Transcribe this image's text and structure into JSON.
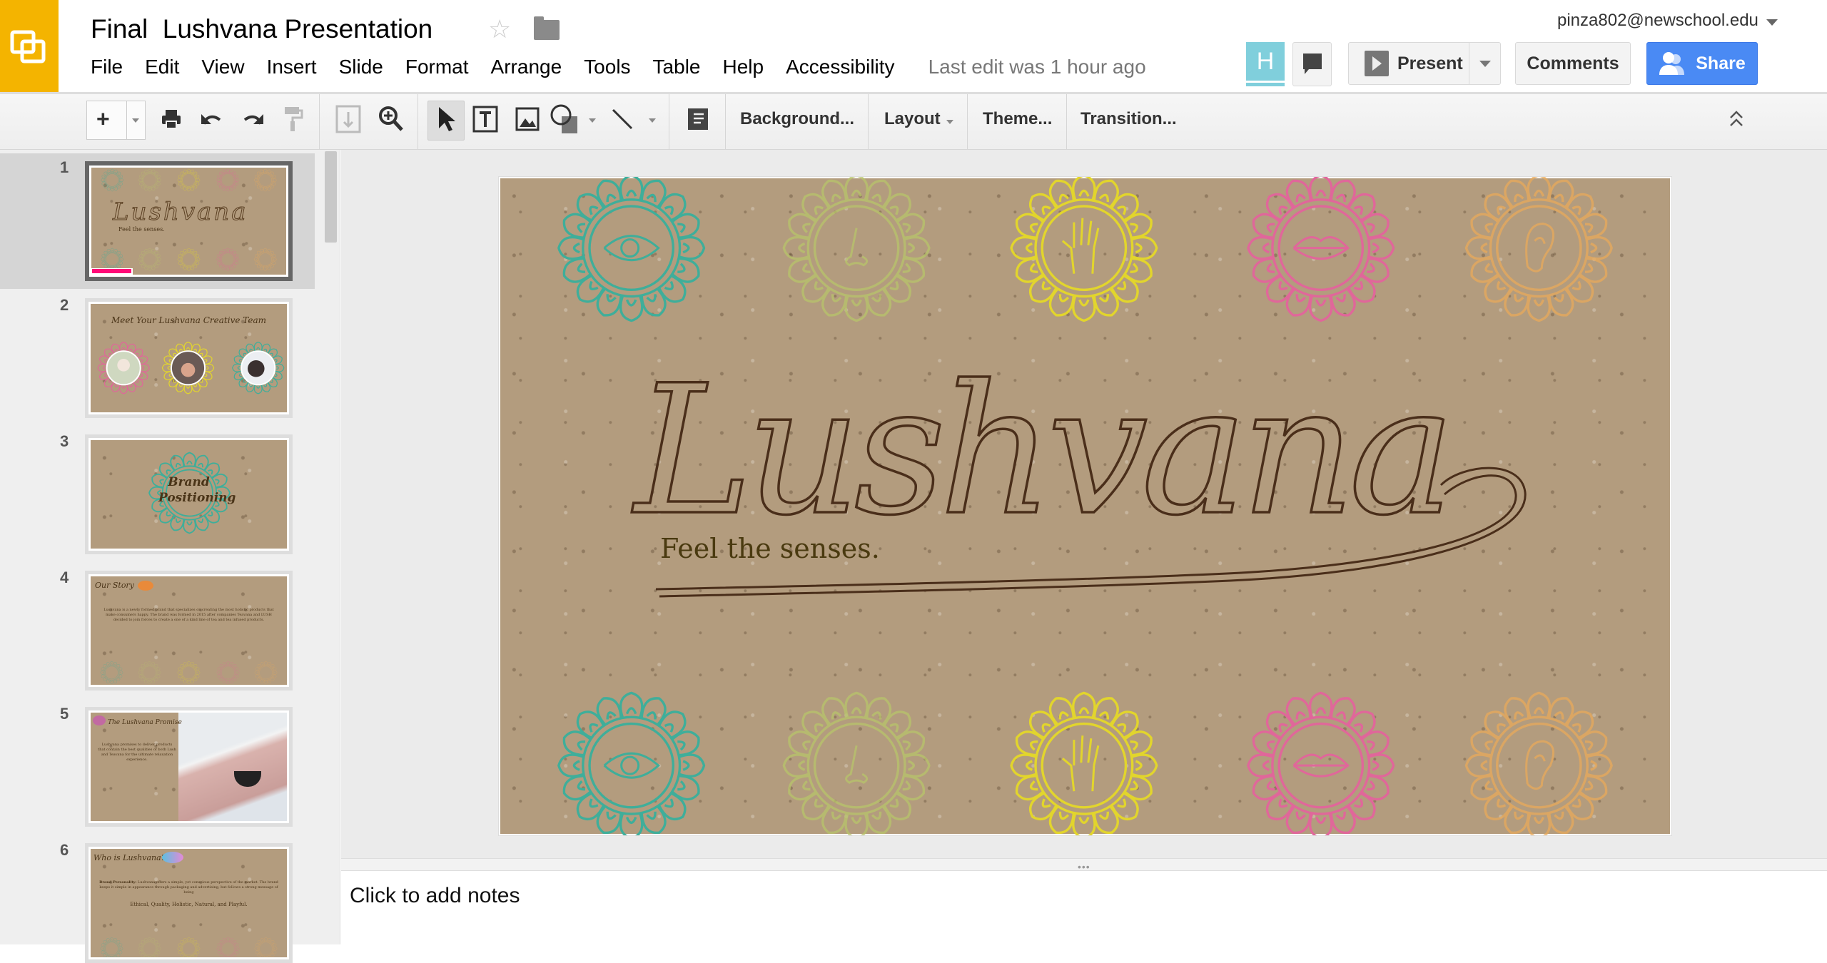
{
  "app": {
    "title": "Final  Lushvana Presentation",
    "account": "pinza802@newschool.edu",
    "collaborator_initial": "H",
    "last_edit": "Last edit was 1 hour ago"
  },
  "menu": [
    "File",
    "Edit",
    "View",
    "Insert",
    "Slide",
    "Format",
    "Arrange",
    "Tools",
    "Table",
    "Help",
    "Accessibility"
  ],
  "header_buttons": {
    "present": "Present",
    "comments": "Comments",
    "share": "Share"
  },
  "toolbar": {
    "background": "Background...",
    "layout": "Layout",
    "theme": "Theme...",
    "transition": "Transition..."
  },
  "colors": {
    "brand": "#f4b400",
    "share": "#4a8af4",
    "collab": "#80cfdc",
    "collab_cursor": "#ff0a78",
    "teal": "#3fae9a",
    "green": "#b8c46a",
    "yellow": "#e2d52c",
    "pink": "#e0679a",
    "orange": "#e9aa5a",
    "ink": "#4a2e1a"
  },
  "slides": [
    {
      "number": "1",
      "title": "Lushvana",
      "subtitle": "Feel the senses."
    },
    {
      "number": "2",
      "title": "Meet Your Lushvana Creative Team"
    },
    {
      "number": "3",
      "title": "Brand Positioning"
    },
    {
      "number": "4",
      "title": "Our Story",
      "body": "Lushvana is a newly formed brand that specializes on creating the most holistic products that make consumers happy. The brand was formed in 2015 after companies Teavana and LUSH decided to join forces to create a one of a kind line of tea and tea infused products."
    },
    {
      "number": "5",
      "title": "The Lushvana Promise",
      "body": "Lushvana promises to deliver products that contain the best qualities of both Lush and Teavana for the ultimate relaxation experience."
    },
    {
      "number": "6",
      "title": "Who is Lushvana?",
      "body_label": "Brand Personality:",
      "body": "Lushvana offers a simple, yet conscious perspective of the market. The brand keeps it simple in appearance through packaging and advertising, but follows a strong message of being",
      "values": "Ethical, Quality, Holistic, Natural, and Playful."
    }
  ],
  "notes": {
    "placeholder": "Click to add notes"
  }
}
